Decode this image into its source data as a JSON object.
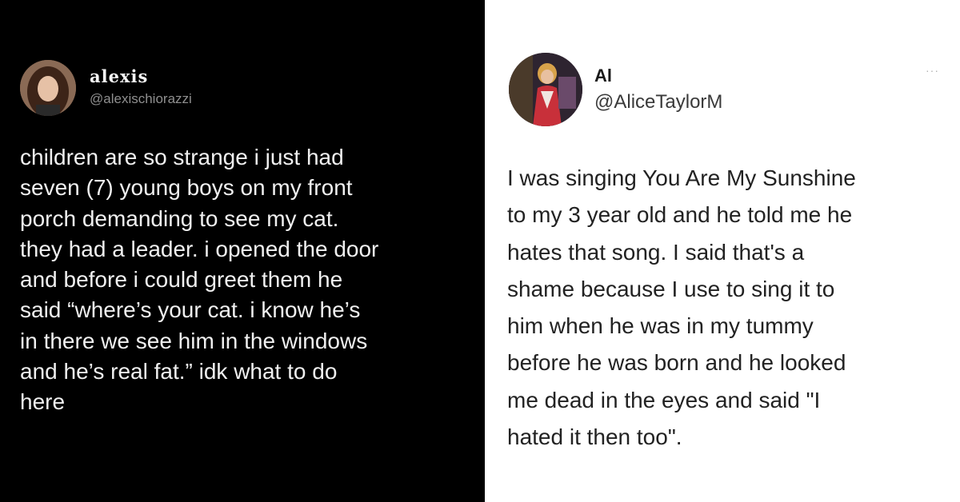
{
  "left_tweet": {
    "display_name": "alexis",
    "handle": "@alexischiorazzi",
    "body_lines": [
      "children are so strange i just had",
      "seven (7) young boys on my front",
      "porch demanding to see my cat.",
      "they had a leader. i opened the door",
      "and before i could greet them he",
      "said “where’s your cat. i know he’s",
      "in there we see him in the windows",
      "and he’s real fat.” idk what to do",
      "here"
    ],
    "theme": {
      "background": "#000000",
      "text": "#f0f0f0",
      "muted": "#8f8f8f"
    }
  },
  "right_tweet": {
    "display_name": "Al",
    "handle": "@AliceTaylorM",
    "more_label": "···",
    "body_lines": [
      "I was singing You Are My Sunshine",
      "to my 3 year old and he told me he",
      "hates that song. I said that's a",
      "shame because I use to sing it to",
      "him when he was in my tummy",
      "before he was born and he looked",
      "me dead in the eyes and said \"I",
      "hated it then too\"."
    ],
    "theme": {
      "background": "#ffffff",
      "text": "#222222",
      "muted": "#3a3a3a"
    }
  }
}
